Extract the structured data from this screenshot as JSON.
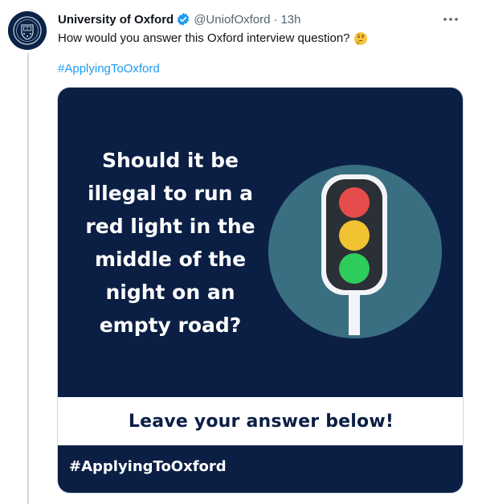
{
  "tweet": {
    "display_name": "University of Oxford",
    "handle": "@UniofOxford",
    "separator": "·",
    "time": "13h",
    "text": "How would you answer this Oxford interview question?",
    "hashtag": "#ApplyingToOxford"
  },
  "media": {
    "question": "Should it be illegal to run a red light in the middle of the night on an empty road?",
    "answer_prompt": "Leave your answer below!",
    "hashtag": "#ApplyingToOxford"
  },
  "colors": {
    "navy": "#0b1f45",
    "circle": "#3a6f82",
    "red_light": "#e74c4c",
    "yellow_light": "#f1c232",
    "green_light": "#2ecc5a",
    "link": "#1d9bf0",
    "verified": "#1d9bf0"
  },
  "icons": {
    "avatar": "oxford-crest",
    "verified": "verified-badge-icon",
    "more": "more-horizontal-icon",
    "emoji": "thinking-face-emoji"
  }
}
